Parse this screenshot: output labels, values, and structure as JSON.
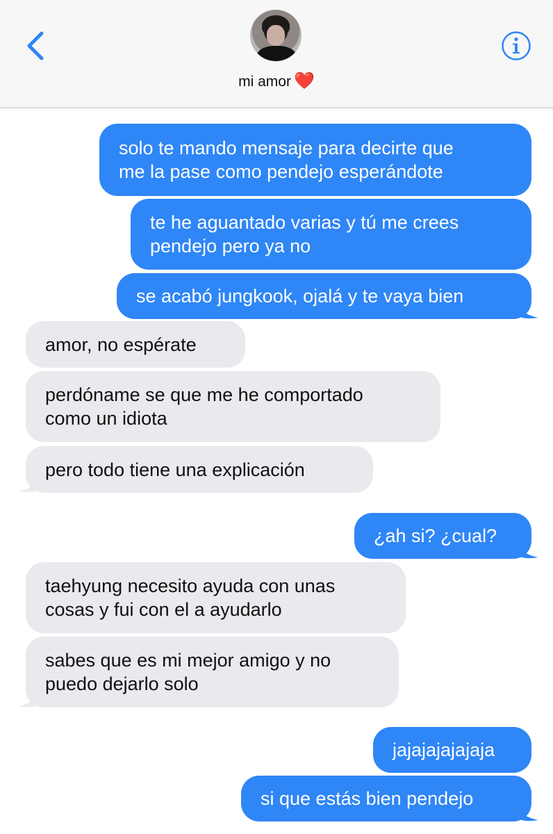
{
  "header": {
    "contact_name": "mi amor",
    "heart_emoji": "❤️",
    "accent_color": "#2f86f6",
    "back_icon": "chevron-left-icon",
    "info_icon": "info-circle-icon"
  },
  "messages": [
    {
      "from": "me",
      "text": "solo te mando mensaje para decirte que\nme la pase como pendejo esperándote"
    },
    {
      "from": "me",
      "text": "te he aguantado varias y tú me crees\npendejo pero ya no"
    },
    {
      "from": "me",
      "text": "se acabó jungkook, ojalá y te vaya bien"
    },
    {
      "from": "them",
      "text": "amor, no espérate"
    },
    {
      "from": "them",
      "text": "perdóname se que me he comportado\ncomo un idiota"
    },
    {
      "from": "them",
      "text": "pero todo tiene una explicación"
    },
    {
      "from": "me",
      "text": "¿ah si? ¿cual?"
    },
    {
      "from": "them",
      "text": "taehyung necesito ayuda con unas\ncosas y fui con el a ayudarlo"
    },
    {
      "from": "them",
      "text": "sabes que es mi mejor amigo y no\npuedo dejarlo solo"
    },
    {
      "from": "me",
      "text": "jajajajajajaja"
    },
    {
      "from": "me",
      "text": "si que estás bien pendejo"
    }
  ]
}
